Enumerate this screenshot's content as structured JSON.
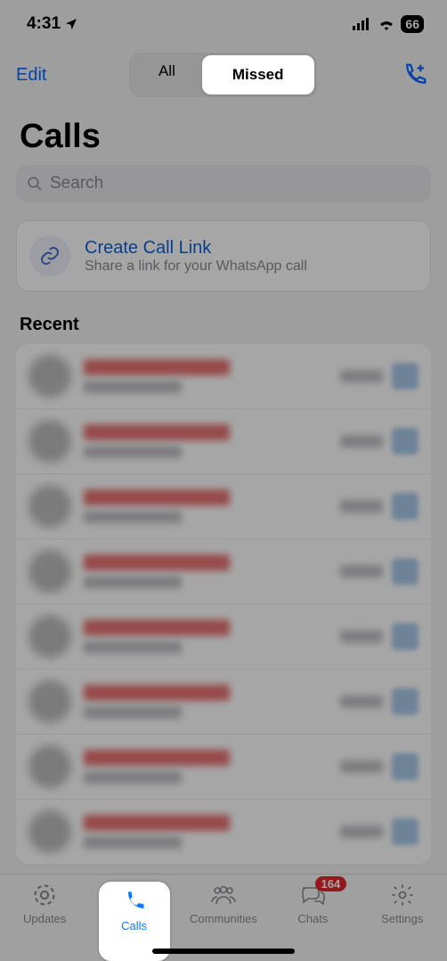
{
  "status": {
    "time": "4:31",
    "battery": "66"
  },
  "nav": {
    "edit": "Edit",
    "segments": {
      "all": "All",
      "missed": "Missed"
    }
  },
  "title": "Calls",
  "search": {
    "placeholder": "Search"
  },
  "link_card": {
    "title": "Create Call Link",
    "subtitle": "Share a link for your WhatsApp call"
  },
  "section": "Recent",
  "tabs": {
    "updates": "Updates",
    "calls": "Calls",
    "communities": "Communities",
    "chats": "Chats",
    "settings": "Settings",
    "chats_badge": "164"
  },
  "rows": 8
}
